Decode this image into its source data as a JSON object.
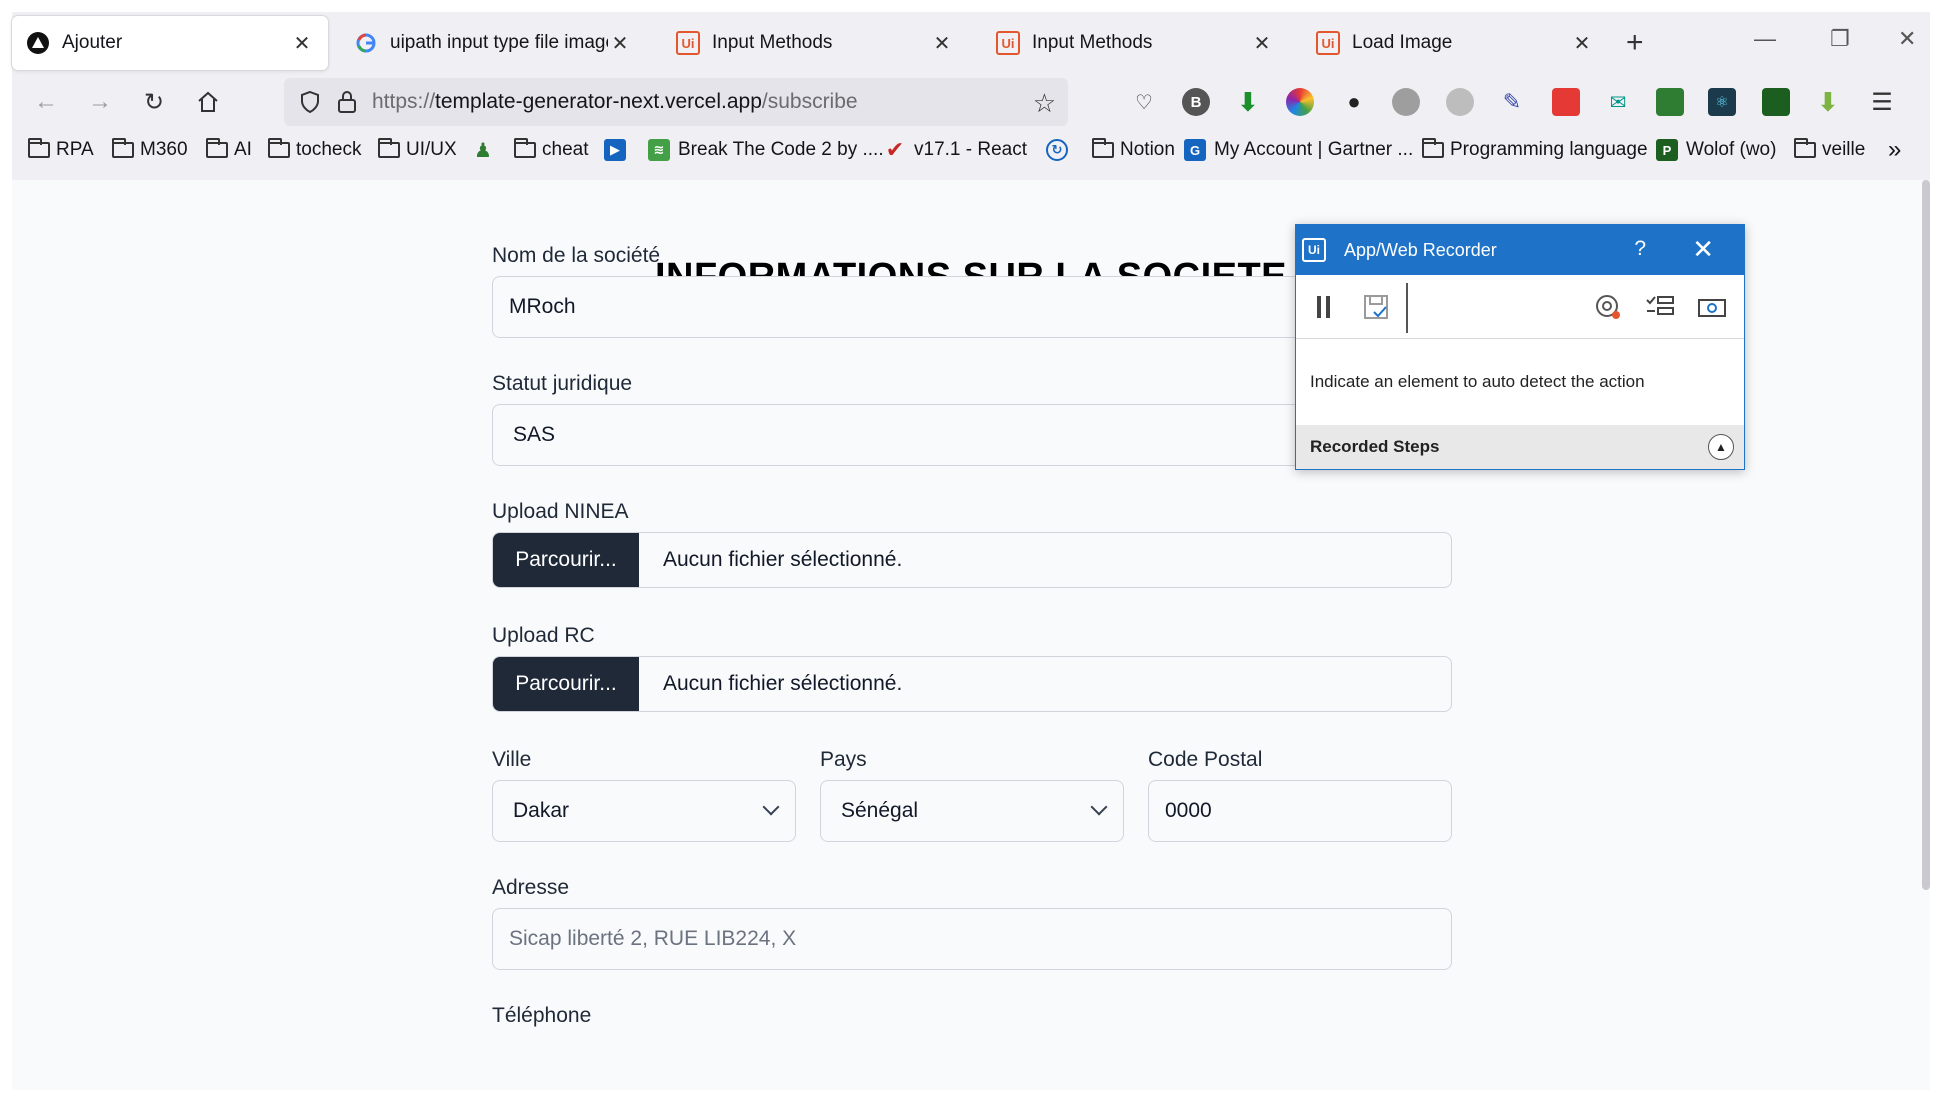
{
  "browser": {
    "tabs": [
      {
        "title": "Ajouter",
        "icon": "vercel-triangle-icon",
        "active": true
      },
      {
        "title": "uipath input type file image -",
        "icon": "google-icon",
        "active": false
      },
      {
        "title": "Input Methods",
        "icon": "uipath-icon",
        "active": false
      },
      {
        "title": "Input Methods",
        "icon": "uipath-icon",
        "active": false
      },
      {
        "title": "Load Image",
        "icon": "uipath-icon",
        "active": false
      }
    ],
    "close_glyph": "✕",
    "new_tab_glyph": "+",
    "url_scheme": "https://",
    "url_host": "template-generator-next.vercel.app",
    "url_path": "/subscribe",
    "bookmarks": [
      {
        "label": "RPA",
        "type": "folder"
      },
      {
        "label": "M360",
        "type": "folder"
      },
      {
        "label": "AI",
        "type": "folder"
      },
      {
        "label": "tocheck",
        "type": "folder"
      },
      {
        "label": "UI/UX",
        "type": "folder"
      },
      {
        "label": "",
        "type": "person-icon"
      },
      {
        "label": "cheat",
        "type": "folder"
      },
      {
        "label": "",
        "type": "video-icon"
      },
      {
        "label": "Break The Code 2 by ....",
        "type": "site"
      },
      {
        "label": "v17.1 - React",
        "type": "site"
      },
      {
        "label": "",
        "type": "sync-icon"
      },
      {
        "label": "Notion",
        "type": "folder"
      },
      {
        "label": "My Account | Gartner ...",
        "type": "site"
      },
      {
        "label": "Programming language",
        "type": "folder"
      },
      {
        "label": "Wolof (wo)",
        "type": "site"
      },
      {
        "label": "veille",
        "type": "folder"
      }
    ],
    "more_glyph": "»"
  },
  "form": {
    "title": "INFORMATIONS SUR LA SOCIETE",
    "company_name_label": "Nom de la société",
    "company_name_value": "MRoch",
    "legal_status_label": "Statut juridique",
    "legal_status_value": "SAS",
    "ninea_label": "Upload NINEA",
    "browse_label": "Parcourir...",
    "no_file_text": "Aucun fichier sélectionné.",
    "rc_label": "Upload RC",
    "city_label": "Ville",
    "city_value": "Dakar",
    "country_label": "Pays",
    "country_value": "Sénégal",
    "postal_label": "Code Postal",
    "postal_value": "0000",
    "address_label": "Adresse",
    "address_placeholder": "Sicap liberté 2, RUE LIB224, X",
    "phone_label": "Téléphone"
  },
  "recorder": {
    "logo": "Ui",
    "title": "App/Web Recorder",
    "help": "?",
    "close": "✕",
    "message": "Indicate an element to auto detect the action",
    "steps_label": "Recorded Steps",
    "accent": "#1e73c8"
  },
  "colors": {
    "browse_button": "#1f2937",
    "page_bg": "#f9fafb"
  }
}
